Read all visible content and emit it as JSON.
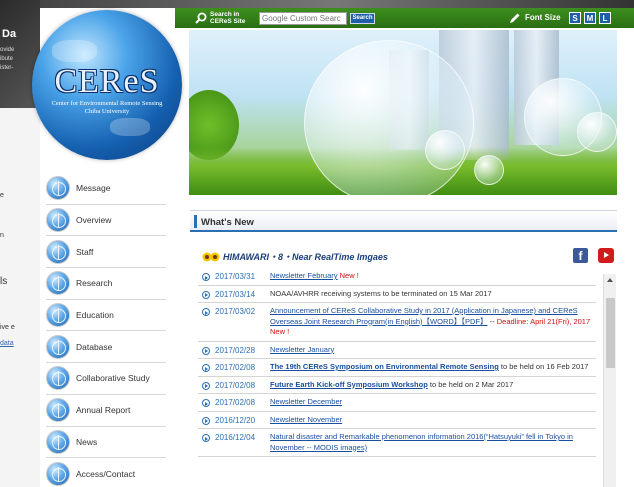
{
  "background_page": {
    "title": "Da",
    "lines": [
      "ovide",
      "ibute",
      "ister-"
    ],
    "fragments": [
      "e",
      "n",
      "ls",
      "ive e",
      "data"
    ]
  },
  "header": {
    "search_label_1": "Search in",
    "search_label_2": "CEReS Site",
    "search_placeholder": "Google Custom Searc",
    "search_button": "Search",
    "font_size_label": "Font Size",
    "font_sizes": [
      "S",
      "M",
      "L"
    ],
    "accent_color": "#2a6e12"
  },
  "logo": {
    "text": "CEReS",
    "subtitle_1": "Center for Environmental Remote Sensing",
    "subtitle_2": "Chiba University"
  },
  "menu": {
    "items": [
      {
        "label": "Message"
      },
      {
        "label": "Overview"
      },
      {
        "label": "Staff"
      },
      {
        "label": "Research"
      },
      {
        "label": "Education"
      },
      {
        "label": "Database"
      },
      {
        "label": "Collaborative Study"
      },
      {
        "label": "Annual Report"
      },
      {
        "label": "News"
      },
      {
        "label": "Access/Contact"
      }
    ]
  },
  "news": {
    "title": "What's New",
    "himawari_label": "HIMAWARI・8・Near RealTime Imgaes",
    "facebook_glyph": "f",
    "items": [
      {
        "date": "2017/03/31",
        "link": "Newsletter February",
        "after": "",
        "red": "New !"
      },
      {
        "date": "2017/03/14",
        "link": "",
        "after": "NOAA/AVHRR receiving systems to be terminated on 15 Mar 2017",
        "red": ""
      },
      {
        "date": "2017/03/02",
        "link": "Announcement of CEReS Collaborative Study in 2017 (Application in Japanese) and CEReS Overseas Joint Research Program(in English)【WORD】【PDF】",
        "after": " -- ",
        "red": "Deadline: April 21(Fri), 2017 New !"
      },
      {
        "date": "2017/02/28",
        "link": "Newsletter January",
        "after": "",
        "red": ""
      },
      {
        "date": "2017/02/08",
        "link": "The 19th CEReS Symposium on Environmental Remote Sensing",
        "after": " to be held on 16 Feb 2017",
        "red": "",
        "bold": true
      },
      {
        "date": "2017/02/08",
        "link": "Future Earth Kick-off Symposium Workshop",
        "after": " to be held on 2 Mar 2017",
        "red": "",
        "bold": true
      },
      {
        "date": "2017/02/08",
        "link": "Newsletter December",
        "after": "",
        "red": ""
      },
      {
        "date": "2016/12/20",
        "link": "Newsletter November",
        "after": "",
        "red": ""
      },
      {
        "date": "2016/12/04",
        "link": "Natural disaster and Remarkable phenomenon information 2016(“Hatsuyuki” fell in Tokyo in November -- MODIS images)",
        "after": "",
        "red": ""
      }
    ]
  }
}
